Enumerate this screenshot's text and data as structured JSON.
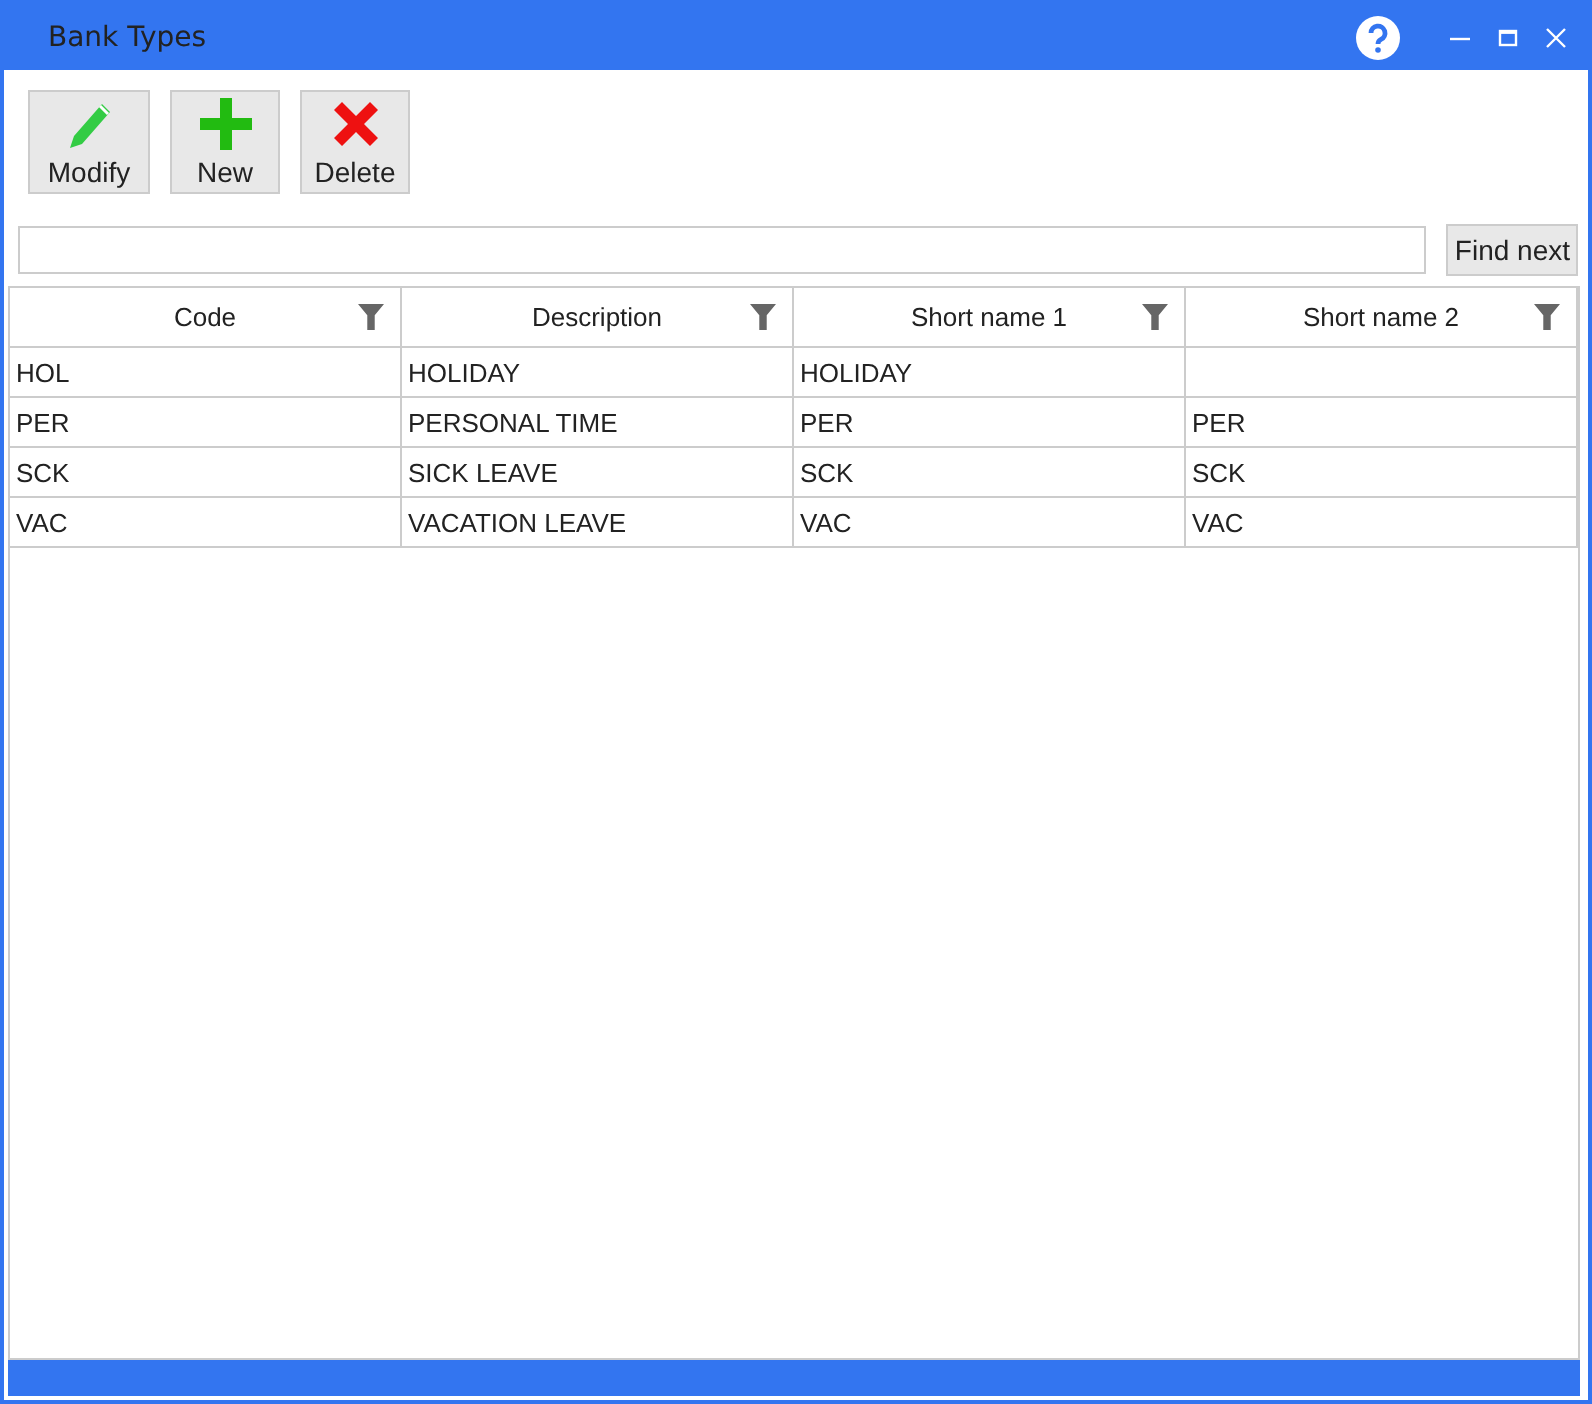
{
  "window": {
    "title": "Bank Types"
  },
  "toolbar": [
    {
      "kind": "modify",
      "label": "Modify"
    },
    {
      "kind": "new",
      "label": "New"
    },
    {
      "kind": "delete",
      "label": "Delete"
    }
  ],
  "search": {
    "button": "Find next"
  },
  "table": {
    "columns": [
      "Code",
      "Description",
      "Short name 1",
      "Short name 2"
    ],
    "rows": [
      [
        "HOL",
        "HOLIDAY",
        "HOLIDAY",
        ""
      ],
      [
        "PER",
        "PERSONAL TIME",
        "PER",
        "PER"
      ],
      [
        "SCK",
        "SICK LEAVE",
        "SCK",
        "SCK"
      ],
      [
        "VAC",
        "VACATION LEAVE",
        "VAC",
        "VAC"
      ]
    ]
  }
}
